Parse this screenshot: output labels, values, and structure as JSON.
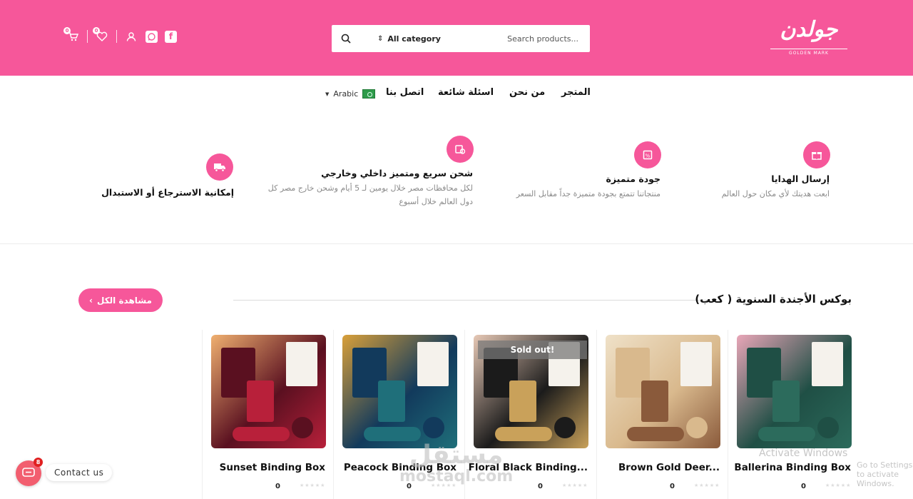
{
  "colors": {
    "brand_pink": "#f6579a",
    "chat_red": "#f25e6f"
  },
  "header": {
    "logo": {
      "mark": "جولدن",
      "sub": "GOLDEN MARK"
    },
    "search": {
      "category": "All category",
      "placeholder": "Search products..."
    },
    "icons": {
      "cart_count": "0",
      "wishlist_count": "0"
    }
  },
  "nav": {
    "items": [
      {
        "label": "المتجر"
      },
      {
        "label": "من نحن"
      },
      {
        "label": "اسئلة شائعة"
      },
      {
        "label": "اتصل بنا"
      }
    ],
    "language": "Arabic"
  },
  "features": [
    {
      "title": "إرسال الهدايا",
      "desc": "ابعت هديتك لأي مكان حول العالم",
      "icon": "gift-icon"
    },
    {
      "title": "جودة متميزة",
      "desc": "منتجاتنا تتمتع بجودة متميزة جداً مقابل السعر",
      "icon": "quality-icon"
    },
    {
      "title": "شحن سريع ومتميز داخلي وخارجي",
      "desc": "لكل محافظات مصر خلال يومين لـ 5 أيام وشحن خارج مصر كل دول العالم خلال أسبوع",
      "icon": "shipping-icon"
    },
    {
      "title": "إمكانية الاسترجاع أو الاستبدال",
      "desc": "",
      "icon": "truck-icon"
    }
  ],
  "section": {
    "title": "بوكس الأجندة السنوية ( كعب)",
    "view_all": "مشاهدة الكل"
  },
  "products": [
    {
      "name": "Ballerina Binding Box",
      "price": "0",
      "sold_out": "",
      "palette": [
        "#1f4f45",
        "#2c6b5c",
        "#e9a6b8"
      ]
    },
    {
      "name": "Brown Gold Deer...",
      "price": "0",
      "sold_out": "",
      "palette": [
        "#d9b98d",
        "#8a5a3b",
        "#efe1c8"
      ]
    },
    {
      "name": "Floral Black Binding...",
      "price": "0",
      "sold_out": "Sold out!",
      "palette": [
        "#1b1b1b",
        "#c9a15a",
        "#e7c9b6"
      ]
    },
    {
      "name": "Peacock Binding Box",
      "price": "0",
      "sold_out": "",
      "palette": [
        "#123a5c",
        "#1f6f7a",
        "#d9a03a"
      ]
    },
    {
      "name": "Sunset Binding Box",
      "price": "0",
      "sold_out": "",
      "palette": [
        "#5a1020",
        "#b8203a",
        "#f0b070"
      ]
    }
  ],
  "overlay": {
    "watermark_ar": "مستقل",
    "watermark_en": "mostaql.com",
    "activate_title": "Activate Windows",
    "activate_sub": "Go to Settings to activate Windows."
  },
  "chat": {
    "label": "Contact us",
    "badge": "8"
  }
}
